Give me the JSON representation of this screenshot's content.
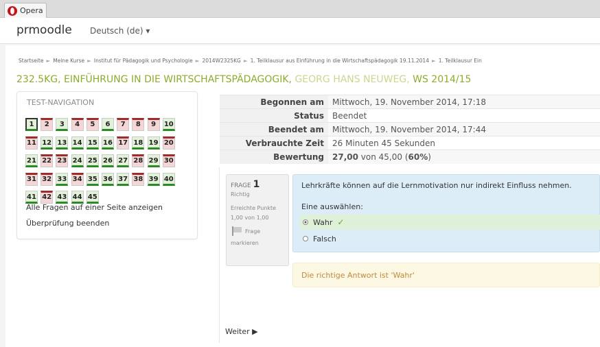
{
  "browser": {
    "tab_label": "Opera"
  },
  "header": {
    "brand": "prmoodle",
    "language": "Deutsch (de) ▾"
  },
  "breadcrumb": [
    "Startseite",
    "Meine Kurse",
    "Institut für Pädagogik und Psychologie",
    "2014W2325KG",
    "1. Teilklausur aus Einführung in die Wirtschaftspädagogik 19.11.2014",
    "1. Teilklausur Ein"
  ],
  "course": {
    "title_main": "232.5KG, EINFÜHRUNG IN DIE WIRTSCHAFTSPÄDAGOGIK,",
    "title_author": "GEORG HANS NEUWEG,",
    "title_term": "WS 2014/15"
  },
  "navigation": {
    "title": "TEST-NAVIGATION",
    "questions": [
      {
        "n": "1",
        "s": "c"
      },
      {
        "n": "2",
        "s": "w"
      },
      {
        "n": "3",
        "s": "c"
      },
      {
        "n": "4",
        "s": "w"
      },
      {
        "n": "5",
        "s": "w"
      },
      {
        "n": "6",
        "s": "c"
      },
      {
        "n": "7",
        "s": "w"
      },
      {
        "n": "8",
        "s": "w"
      },
      {
        "n": "9",
        "s": "w"
      },
      {
        "n": "10",
        "s": "c"
      },
      {
        "n": "11",
        "s": "w"
      },
      {
        "n": "12",
        "s": "c"
      },
      {
        "n": "13",
        "s": "c"
      },
      {
        "n": "14",
        "s": "c"
      },
      {
        "n": "15",
        "s": "c"
      },
      {
        "n": "16",
        "s": "c"
      },
      {
        "n": "17",
        "s": "w"
      },
      {
        "n": "18",
        "s": "c"
      },
      {
        "n": "19",
        "s": "c"
      },
      {
        "n": "20",
        "s": "w"
      },
      {
        "n": "21",
        "s": "c"
      },
      {
        "n": "22",
        "s": "w"
      },
      {
        "n": "23",
        "s": "w"
      },
      {
        "n": "24",
        "s": "c"
      },
      {
        "n": "25",
        "s": "c"
      },
      {
        "n": "26",
        "s": "c"
      },
      {
        "n": "27",
        "s": "c"
      },
      {
        "n": "28",
        "s": "w"
      },
      {
        "n": "29",
        "s": "c"
      },
      {
        "n": "30",
        "s": "w"
      },
      {
        "n": "31",
        "s": "w"
      },
      {
        "n": "32",
        "s": "w"
      },
      {
        "n": "33",
        "s": "c"
      },
      {
        "n": "34",
        "s": "w"
      },
      {
        "n": "35",
        "s": "c"
      },
      {
        "n": "36",
        "s": "c"
      },
      {
        "n": "37",
        "s": "c"
      },
      {
        "n": "38",
        "s": "w"
      },
      {
        "n": "39",
        "s": "c"
      },
      {
        "n": "40",
        "s": "c"
      },
      {
        "n": "41",
        "s": "c"
      },
      {
        "n": "42",
        "s": "w"
      },
      {
        "n": "43",
        "s": "c"
      },
      {
        "n": "44",
        "s": "c"
      },
      {
        "n": "45",
        "s": "c"
      }
    ],
    "show_all_link": "Alle Fragen auf einer Seite anzeigen",
    "finish_link": "Überprüfung beenden"
  },
  "summary": [
    {
      "label": "Begonnen am",
      "value": "Mittwoch, 19. November 2014, 17:18"
    },
    {
      "label": "Status",
      "value": "Beendet"
    },
    {
      "label": "Beendet am",
      "value": "Mittwoch, 19. November 2014, 17:44"
    },
    {
      "label": "Verbrauchte Zeit",
      "value": "26 Minuten 45 Sekunden"
    },
    {
      "label": "Bewertung",
      "value_bold": "27,00",
      "value_rest": " von 45,00 (",
      "percent": "60%",
      "value_end": ")"
    }
  ],
  "question": {
    "label": "FRAGE",
    "number": "1",
    "state": "Richtig",
    "points_label": "Erreichte Punkte",
    "points": "1,00 von 1,00",
    "flag_label_1": "Frage",
    "flag_label_2": "markieren",
    "text": "Lehrkräfte können auf die Lernmotivation nur indirekt Einfluss nehmen.",
    "prompt": "Eine auswählen:",
    "answers": [
      "Wahr",
      "Falsch"
    ],
    "feedback": "Die richtige Antwort ist 'Wahr'"
  },
  "footer": {
    "next_label": "Weiter ▶"
  },
  "colors": {
    "correct": "#2a8a24",
    "wrong": "#a12a2a",
    "title_green": "#8dac2c"
  }
}
